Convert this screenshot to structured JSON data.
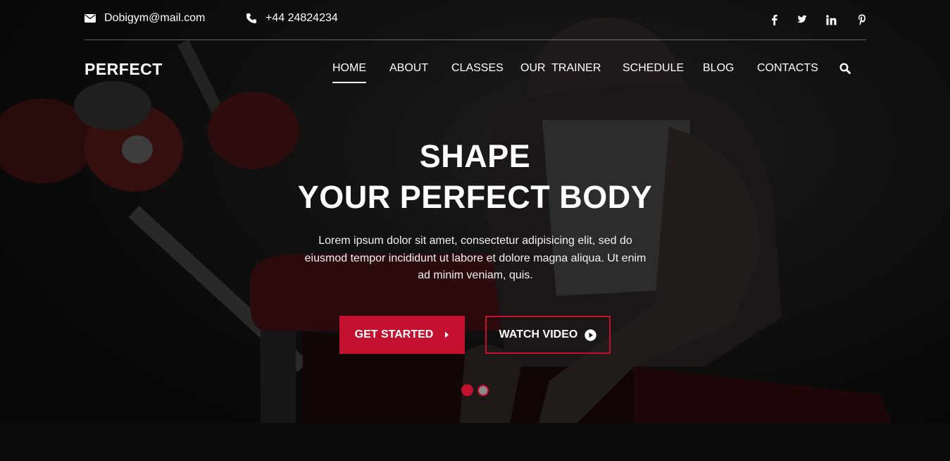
{
  "topbar": {
    "email": "Dobigym@mail.com",
    "phone": "+44 24824234",
    "social": [
      "facebook-icon",
      "twitter-icon",
      "linkedin-icon",
      "pinterest-icon"
    ]
  },
  "brand": {
    "logo": "PERFECT"
  },
  "nav": {
    "items": [
      {
        "label": "HOME",
        "active": true
      },
      {
        "label": "ABOUT"
      },
      {
        "label": "CLASSES"
      },
      {
        "label": "OUR  TRAINER"
      },
      {
        "label": "SCHEDULE"
      },
      {
        "label": "BLOG"
      },
      {
        "label": "CONTACTS"
      }
    ]
  },
  "hero": {
    "title_line1": "SHAPE",
    "title_line2": "YOUR PERFECT BODY",
    "description": "Lorem ipsum dolor sit amet, consectetur adipisicing elit, sed do eiusmod tempor incididunt ut labore et dolore magna aliqua. Ut enim ad minim veniam, quis.",
    "primary_button": "GET STARTED",
    "secondary_button": "WATCH VIDEO"
  },
  "slider": {
    "active_slide": 1,
    "slide_count": 2
  },
  "colors": {
    "accent": "#c4102f",
    "text": "#ffffff",
    "background": "#0b0b0b"
  }
}
